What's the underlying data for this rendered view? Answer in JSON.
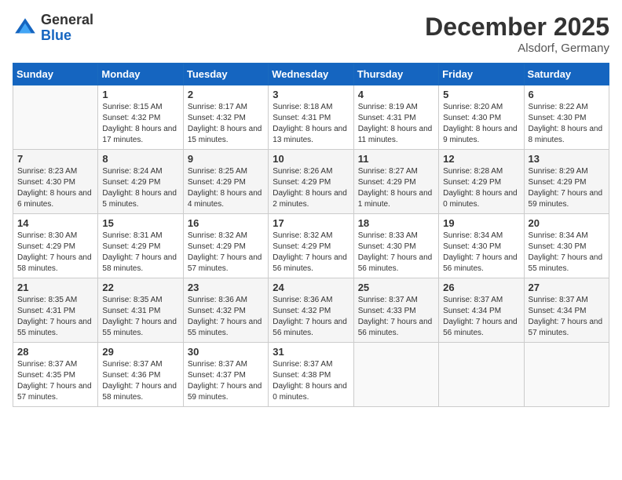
{
  "header": {
    "logo": {
      "general": "General",
      "blue": "Blue"
    },
    "title": "December 2025",
    "location": "Alsdorf, Germany"
  },
  "calendar": {
    "days_of_week": [
      "Sunday",
      "Monday",
      "Tuesday",
      "Wednesday",
      "Thursday",
      "Friday",
      "Saturday"
    ],
    "weeks": [
      [
        {
          "day": "",
          "sunrise": "",
          "sunset": "",
          "daylight": ""
        },
        {
          "day": "1",
          "sunrise": "Sunrise: 8:15 AM",
          "sunset": "Sunset: 4:32 PM",
          "daylight": "Daylight: 8 hours and 17 minutes."
        },
        {
          "day": "2",
          "sunrise": "Sunrise: 8:17 AM",
          "sunset": "Sunset: 4:32 PM",
          "daylight": "Daylight: 8 hours and 15 minutes."
        },
        {
          "day": "3",
          "sunrise": "Sunrise: 8:18 AM",
          "sunset": "Sunset: 4:31 PM",
          "daylight": "Daylight: 8 hours and 13 minutes."
        },
        {
          "day": "4",
          "sunrise": "Sunrise: 8:19 AM",
          "sunset": "Sunset: 4:31 PM",
          "daylight": "Daylight: 8 hours and 11 minutes."
        },
        {
          "day": "5",
          "sunrise": "Sunrise: 8:20 AM",
          "sunset": "Sunset: 4:30 PM",
          "daylight": "Daylight: 8 hours and 9 minutes."
        },
        {
          "day": "6",
          "sunrise": "Sunrise: 8:22 AM",
          "sunset": "Sunset: 4:30 PM",
          "daylight": "Daylight: 8 hours and 8 minutes."
        }
      ],
      [
        {
          "day": "7",
          "sunrise": "Sunrise: 8:23 AM",
          "sunset": "Sunset: 4:30 PM",
          "daylight": "Daylight: 8 hours and 6 minutes."
        },
        {
          "day": "8",
          "sunrise": "Sunrise: 8:24 AM",
          "sunset": "Sunset: 4:29 PM",
          "daylight": "Daylight: 8 hours and 5 minutes."
        },
        {
          "day": "9",
          "sunrise": "Sunrise: 8:25 AM",
          "sunset": "Sunset: 4:29 PM",
          "daylight": "Daylight: 8 hours and 4 minutes."
        },
        {
          "day": "10",
          "sunrise": "Sunrise: 8:26 AM",
          "sunset": "Sunset: 4:29 PM",
          "daylight": "Daylight: 8 hours and 2 minutes."
        },
        {
          "day": "11",
          "sunrise": "Sunrise: 8:27 AM",
          "sunset": "Sunset: 4:29 PM",
          "daylight": "Daylight: 8 hours and 1 minute."
        },
        {
          "day": "12",
          "sunrise": "Sunrise: 8:28 AM",
          "sunset": "Sunset: 4:29 PM",
          "daylight": "Daylight: 8 hours and 0 minutes."
        },
        {
          "day": "13",
          "sunrise": "Sunrise: 8:29 AM",
          "sunset": "Sunset: 4:29 PM",
          "daylight": "Daylight: 7 hours and 59 minutes."
        }
      ],
      [
        {
          "day": "14",
          "sunrise": "Sunrise: 8:30 AM",
          "sunset": "Sunset: 4:29 PM",
          "daylight": "Daylight: 7 hours and 58 minutes."
        },
        {
          "day": "15",
          "sunrise": "Sunrise: 8:31 AM",
          "sunset": "Sunset: 4:29 PM",
          "daylight": "Daylight: 7 hours and 58 minutes."
        },
        {
          "day": "16",
          "sunrise": "Sunrise: 8:32 AM",
          "sunset": "Sunset: 4:29 PM",
          "daylight": "Daylight: 7 hours and 57 minutes."
        },
        {
          "day": "17",
          "sunrise": "Sunrise: 8:32 AM",
          "sunset": "Sunset: 4:29 PM",
          "daylight": "Daylight: 7 hours and 56 minutes."
        },
        {
          "day": "18",
          "sunrise": "Sunrise: 8:33 AM",
          "sunset": "Sunset: 4:30 PM",
          "daylight": "Daylight: 7 hours and 56 minutes."
        },
        {
          "day": "19",
          "sunrise": "Sunrise: 8:34 AM",
          "sunset": "Sunset: 4:30 PM",
          "daylight": "Daylight: 7 hours and 56 minutes."
        },
        {
          "day": "20",
          "sunrise": "Sunrise: 8:34 AM",
          "sunset": "Sunset: 4:30 PM",
          "daylight": "Daylight: 7 hours and 55 minutes."
        }
      ],
      [
        {
          "day": "21",
          "sunrise": "Sunrise: 8:35 AM",
          "sunset": "Sunset: 4:31 PM",
          "daylight": "Daylight: 7 hours and 55 minutes."
        },
        {
          "day": "22",
          "sunrise": "Sunrise: 8:35 AM",
          "sunset": "Sunset: 4:31 PM",
          "daylight": "Daylight: 7 hours and 55 minutes."
        },
        {
          "day": "23",
          "sunrise": "Sunrise: 8:36 AM",
          "sunset": "Sunset: 4:32 PM",
          "daylight": "Daylight: 7 hours and 55 minutes."
        },
        {
          "day": "24",
          "sunrise": "Sunrise: 8:36 AM",
          "sunset": "Sunset: 4:32 PM",
          "daylight": "Daylight: 7 hours and 56 minutes."
        },
        {
          "day": "25",
          "sunrise": "Sunrise: 8:37 AM",
          "sunset": "Sunset: 4:33 PM",
          "daylight": "Daylight: 7 hours and 56 minutes."
        },
        {
          "day": "26",
          "sunrise": "Sunrise: 8:37 AM",
          "sunset": "Sunset: 4:34 PM",
          "daylight": "Daylight: 7 hours and 56 minutes."
        },
        {
          "day": "27",
          "sunrise": "Sunrise: 8:37 AM",
          "sunset": "Sunset: 4:34 PM",
          "daylight": "Daylight: 7 hours and 57 minutes."
        }
      ],
      [
        {
          "day": "28",
          "sunrise": "Sunrise: 8:37 AM",
          "sunset": "Sunset: 4:35 PM",
          "daylight": "Daylight: 7 hours and 57 minutes."
        },
        {
          "day": "29",
          "sunrise": "Sunrise: 8:37 AM",
          "sunset": "Sunset: 4:36 PM",
          "daylight": "Daylight: 7 hours and 58 minutes."
        },
        {
          "day": "30",
          "sunrise": "Sunrise: 8:37 AM",
          "sunset": "Sunset: 4:37 PM",
          "daylight": "Daylight: 7 hours and 59 minutes."
        },
        {
          "day": "31",
          "sunrise": "Sunrise: 8:37 AM",
          "sunset": "Sunset: 4:38 PM",
          "daylight": "Daylight: 8 hours and 0 minutes."
        },
        {
          "day": "",
          "sunrise": "",
          "sunset": "",
          "daylight": ""
        },
        {
          "day": "",
          "sunrise": "",
          "sunset": "",
          "daylight": ""
        },
        {
          "day": "",
          "sunrise": "",
          "sunset": "",
          "daylight": ""
        }
      ]
    ]
  }
}
